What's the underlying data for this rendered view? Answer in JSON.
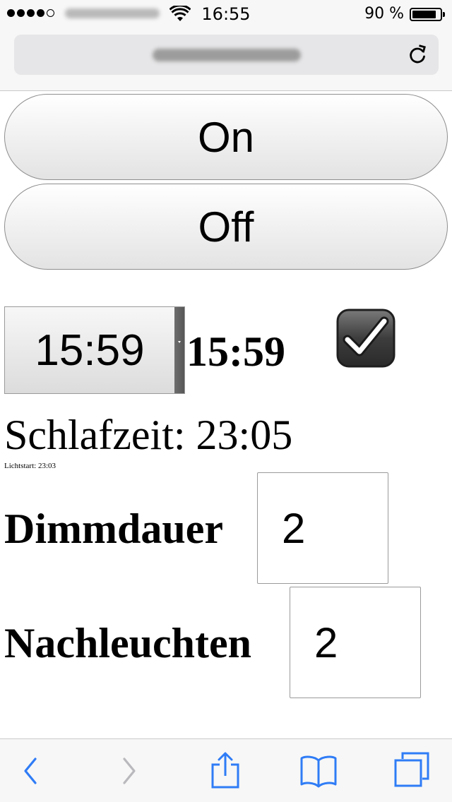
{
  "status_bar": {
    "time": "16:55",
    "battery": "90 %",
    "signal_dots": 5,
    "signal_filled": 4
  },
  "browser": {
    "toolbar_icons": [
      "back-icon",
      "forward-icon",
      "share-icon",
      "bookmarks-icon",
      "tabs-icon"
    ],
    "accent_color": "#2f7cf6",
    "disabled_color": "#b9b9bd"
  },
  "controls": {
    "on_label": "On",
    "off_label": "Off",
    "time_select_value": "15:59",
    "time_display": "15:59",
    "checkbox_checked": true,
    "schlafzeit": "Schlafzeit: 23:05",
    "lichtstart": "Lichtstart: 23:03",
    "dimmdauer_label": "Dimmdauer",
    "dimmdauer_value": "2",
    "nachleuchten_label": "Nachleuchten",
    "nachleuchten_value": "2"
  }
}
